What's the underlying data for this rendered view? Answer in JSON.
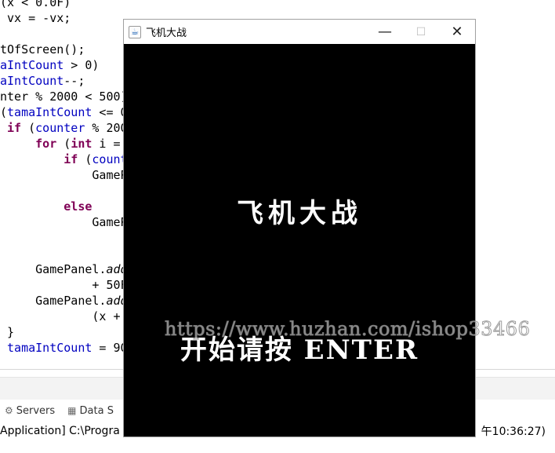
{
  "code_lines": [
    "(x < 0.0F)",
    " vx = -vx;",
    "",
    "tOfScreen();",
    "aIntCount > 0)",
    "aIntCount--;",
    "nter % 2000 < 500)",
    "(tamaIntCount <= 0",
    " if (counter % 200",
    "     for (int i =",
    "         if (count",
    "             GameP",
    "",
    "         else",
    "             GameP",
    "",
    "",
    "     GamePanel.add",
    "             + 50F",
    "     GamePanel.add",
    "             (x +",
    " }",
    " tamaIntCount = 90"
  ],
  "ide": {
    "tabs": [
      {
        "icon": "servers-icon",
        "label": "Servers"
      },
      {
        "icon": "data-source-icon",
        "label": "Data S"
      }
    ],
    "console_left": "Application] C:\\Progra",
    "console_right": "午10:36:27)"
  },
  "window": {
    "title": "飞机大战",
    "minimize_glyph": "—",
    "maximize_glyph": "☐",
    "close_glyph": "✕",
    "icon_glyph": "☕"
  },
  "game": {
    "title": "飞机大战",
    "prompt": "开始请按 ENTER"
  },
  "watermark": "https://www.huzhan.com/ishop33466"
}
